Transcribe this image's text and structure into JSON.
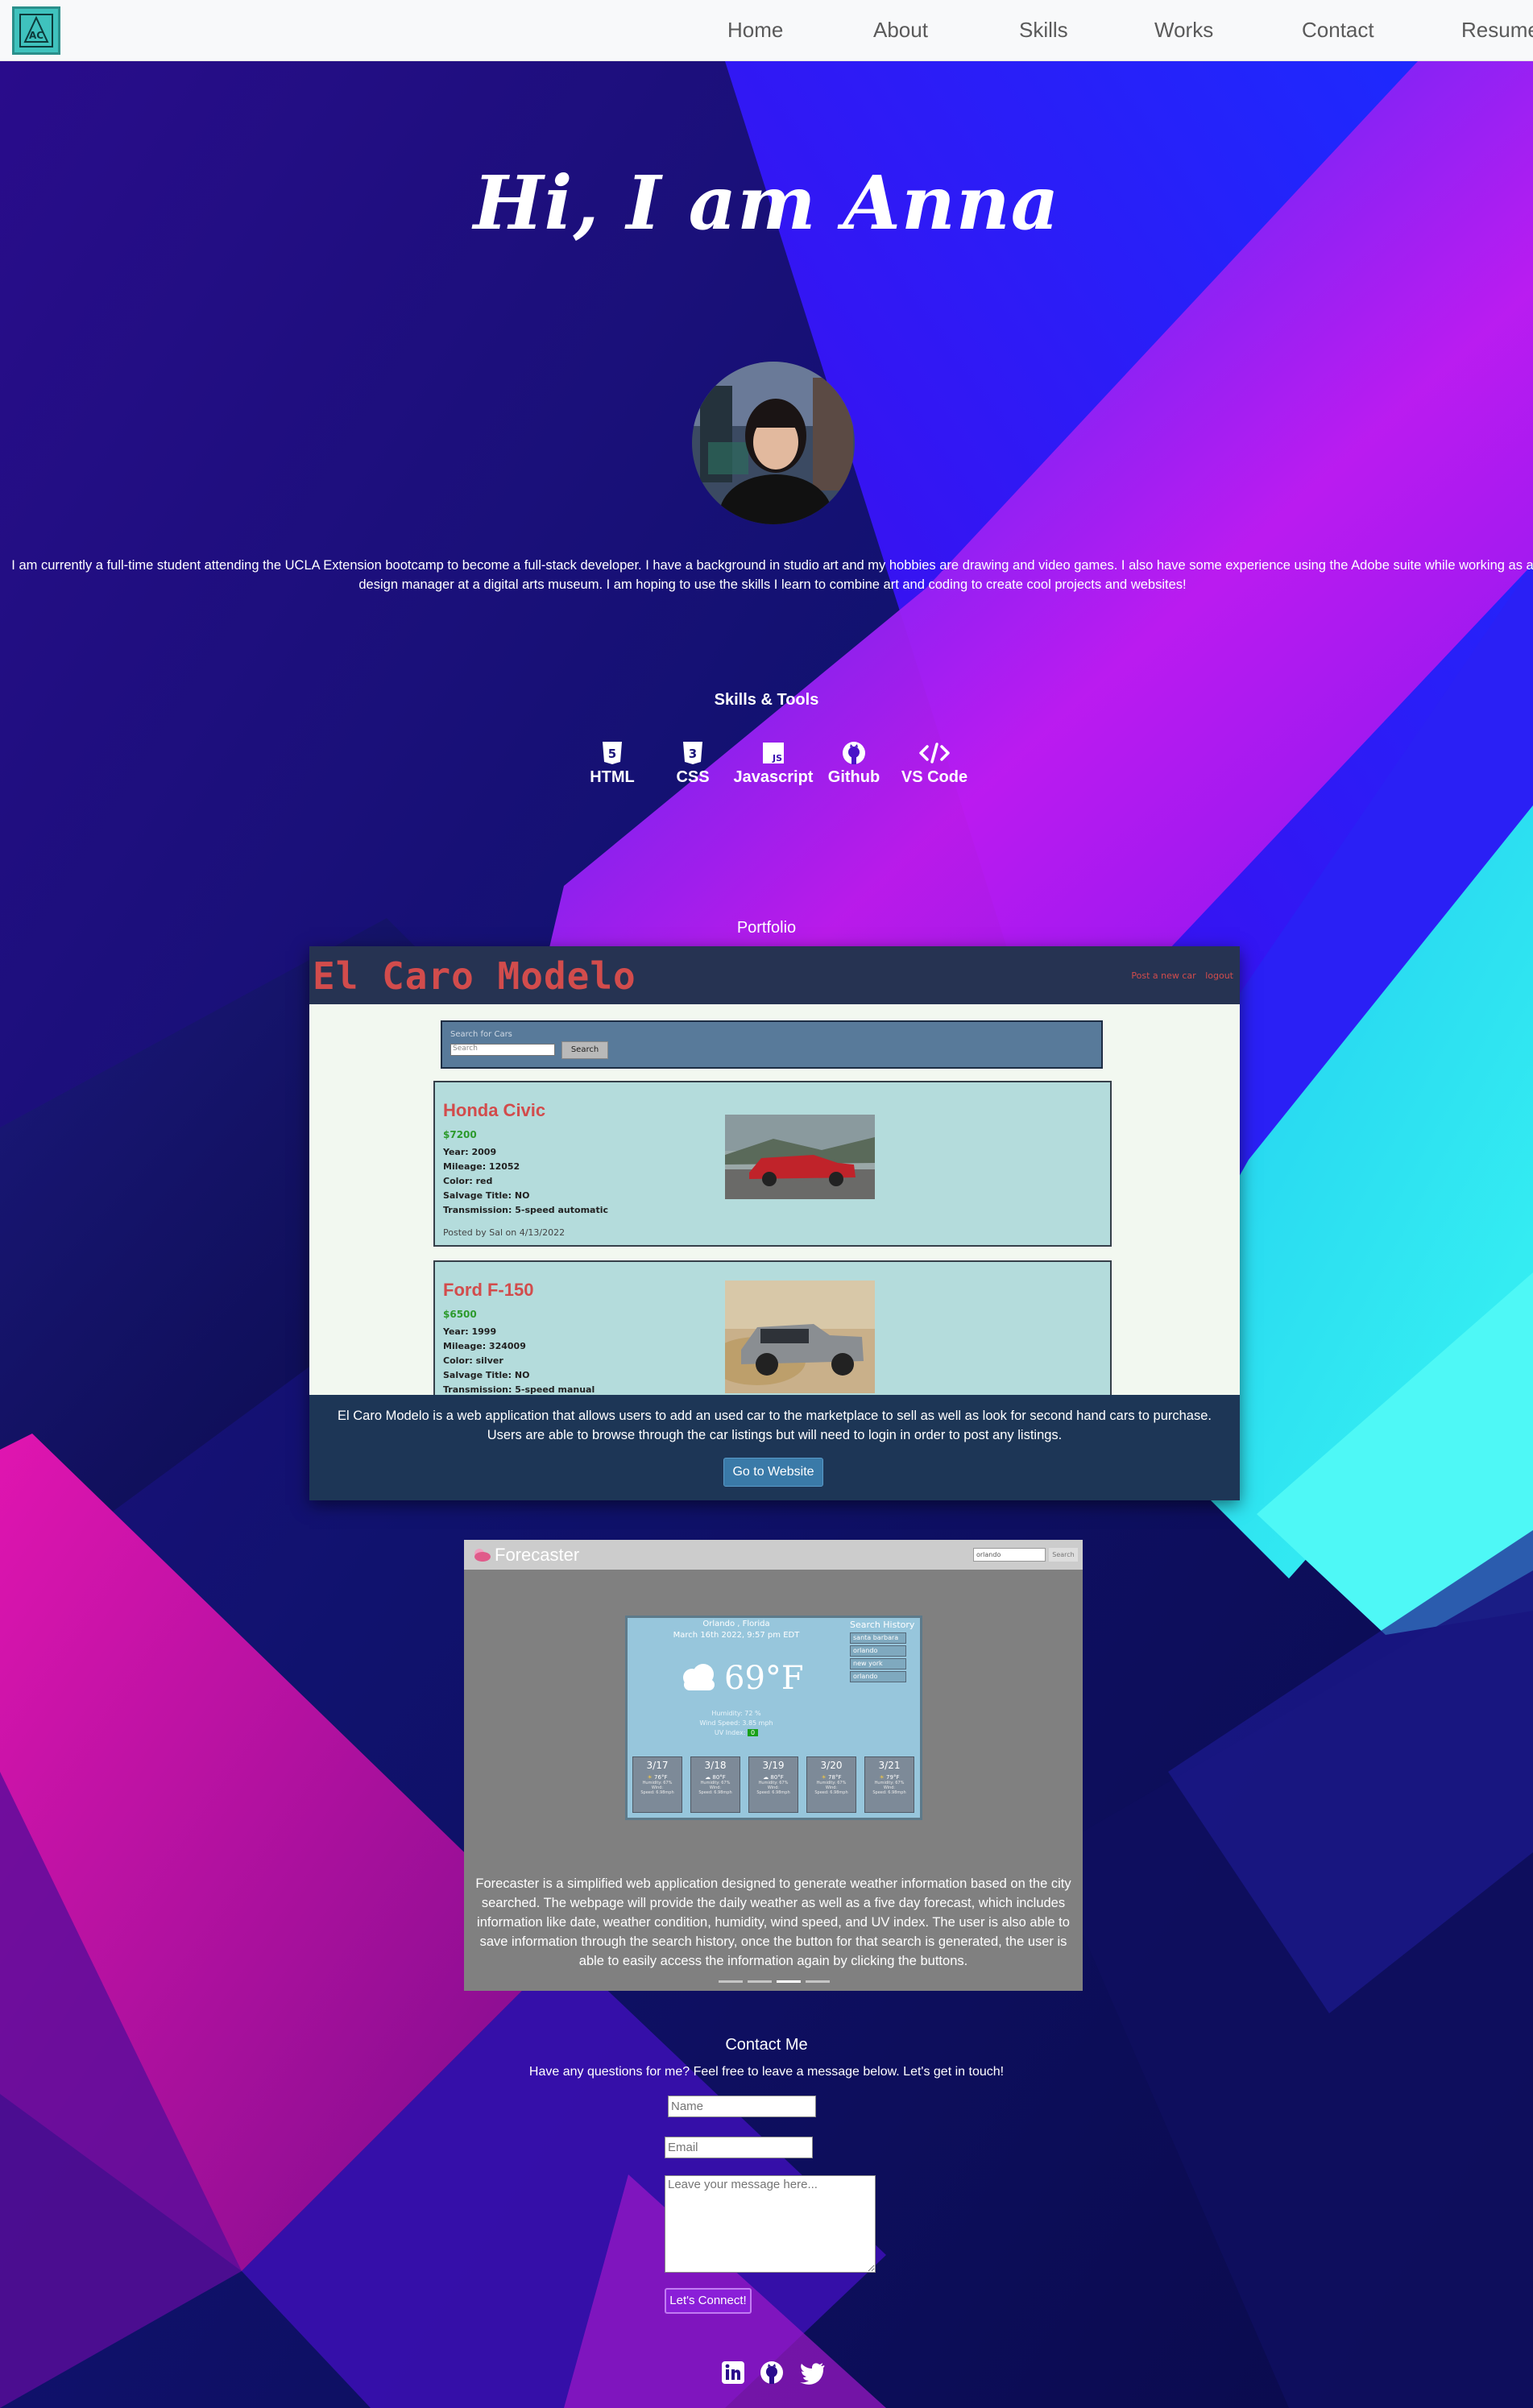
{
  "nav": {
    "logo": "AC logo",
    "links": [
      "Home",
      "About",
      "Skills",
      "Works",
      "Contact",
      "Resume"
    ]
  },
  "hero": {
    "title": "Hi, I am Anna",
    "about": "I am currently a full-time student attending the UCLA Extension bootcamp to become a full-stack developer. I have a background in studio art and my hobbies are drawing and video games. I also have some experience using the Adobe suite while working as a design manager at a digital arts museum. I am hoping to use the skills I learn to combine art and coding to create cool projects and websites!"
  },
  "skills": {
    "heading": "Skills & Tools",
    "items": [
      {
        "label": "HTML",
        "icon": "html5-icon"
      },
      {
        "label": "CSS",
        "icon": "css3-icon"
      },
      {
        "label": "Javascript",
        "icon": "js-icon"
      },
      {
        "label": "Github",
        "icon": "github-icon"
      },
      {
        "label": "VS Code",
        "icon": "code-icon"
      }
    ]
  },
  "portfolio": {
    "heading": "Portfolio",
    "project1": {
      "app_title": "El Caro Modelo",
      "nav_links": [
        "Post a new car",
        "logout"
      ],
      "search_label": "Search for Cars",
      "search_placeholder": "Search",
      "search_button": "Search",
      "listings": [
        {
          "title": "Honda Civic",
          "price": "$7200",
          "lines": [
            "Year: 2009",
            "Mileage: 12052",
            "Color: red",
            "Salvage Title: NO",
            "Transmission: 5-speed automatic"
          ],
          "posted": "Posted by Sal on 4/13/2022"
        },
        {
          "title": "Ford F-150",
          "price": "$6500",
          "lines": [
            "Year: 1999",
            "Mileage: 324009",
            "Color: silver",
            "Salvage Title: NO",
            "Transmission: 5-speed manual"
          ],
          "posted": ""
        }
      ],
      "description": "El Caro Modelo is a web application that allows users to add an used car to the marketplace to sell as well as look for second hand cars to purchase. Users are able to browse through the car listings but will need to login in order to post any listings.",
      "button": "Go to Website"
    },
    "project2": {
      "app_title": "Forecaster",
      "search_value": "orlando",
      "search_button": "Search",
      "city": "Orlando , Florida",
      "date": "March 16th 2022, 9:57 pm EDT",
      "temp": "69°F",
      "humidity": "Humidity: 72 %",
      "wind": "Wind Speed: 3.85 mph",
      "uv_label": "UV Index:",
      "uv_value": "0",
      "history_title": "Search History",
      "history": [
        "santa barbara",
        "orlando",
        "new york",
        "orlando"
      ],
      "days": [
        {
          "date": "3/17",
          "temp": "76°F",
          "icon": "sun-icon"
        },
        {
          "date": "3/18",
          "temp": "80°F",
          "icon": "cloud-icon"
        },
        {
          "date": "3/19",
          "temp": "80°F",
          "icon": "cloud-icon"
        },
        {
          "date": "3/20",
          "temp": "78°F",
          "icon": "sun-icon"
        },
        {
          "date": "3/21",
          "temp": "79°F",
          "icon": "sun-icon"
        }
      ],
      "day_lines": [
        "Humidity: 67%",
        "Wind:",
        "Speed: 6.98mph"
      ],
      "description": "Forecaster is a simplified web application designed to generate weather information based on the city searched. The webpage will provide the daily weather as well as a five day forecast, which includes information like date, weather condition, humidity, wind speed, and UV index. The user is also able to save information through the search history, once the button for that search is generated, the user is able to easily access the information again by clicking the buttons.",
      "carousel_active_index": 2,
      "carousel_count": 4
    }
  },
  "contact": {
    "heading": "Contact Me",
    "subtitle": "Have any questions for me? Feel free to leave a message below. Let's get in touch!",
    "name_placeholder": "Name",
    "email_placeholder": "Email",
    "message_placeholder": "Leave your message here...",
    "button": "Let's Connect!"
  },
  "social": [
    "linkedin-icon",
    "github-icon",
    "twitter-icon"
  ],
  "colors": {
    "bg_dark": "#12106a",
    "magenta": "#c21bf0",
    "cyan": "#2ff0f0",
    "pink": "#e014a8",
    "ecm_red": "#d24c4c",
    "button_purple": "#8a1fd8"
  }
}
